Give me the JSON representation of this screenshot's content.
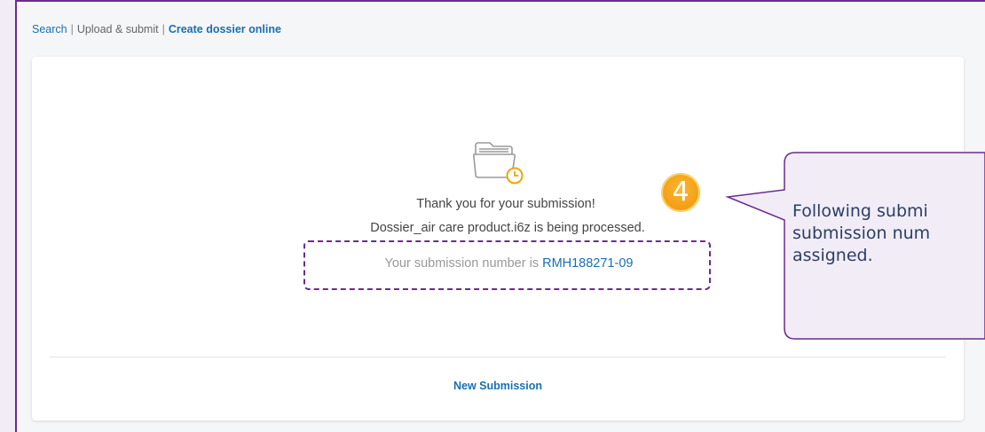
{
  "nav": {
    "search": "Search",
    "sep1": "|",
    "upload": "Upload & submit",
    "sep2": "|",
    "create": "Create dossier online"
  },
  "confirmation": {
    "thanks": "Thank you for your submission!",
    "processed": "Dossier_air care product.i6z is being processed.",
    "number_prefix": "Your submission number is",
    "number": "RMH188271-09",
    "new_submission": "New Submission"
  },
  "annotation": {
    "step": "4",
    "text": "Following submi\nsubmission num\nassigned."
  },
  "colors": {
    "accent": "#6a2c8e",
    "link": "#1a6fb0",
    "badge": "#f39c12",
    "callout_bg": "#f1ecf6"
  }
}
